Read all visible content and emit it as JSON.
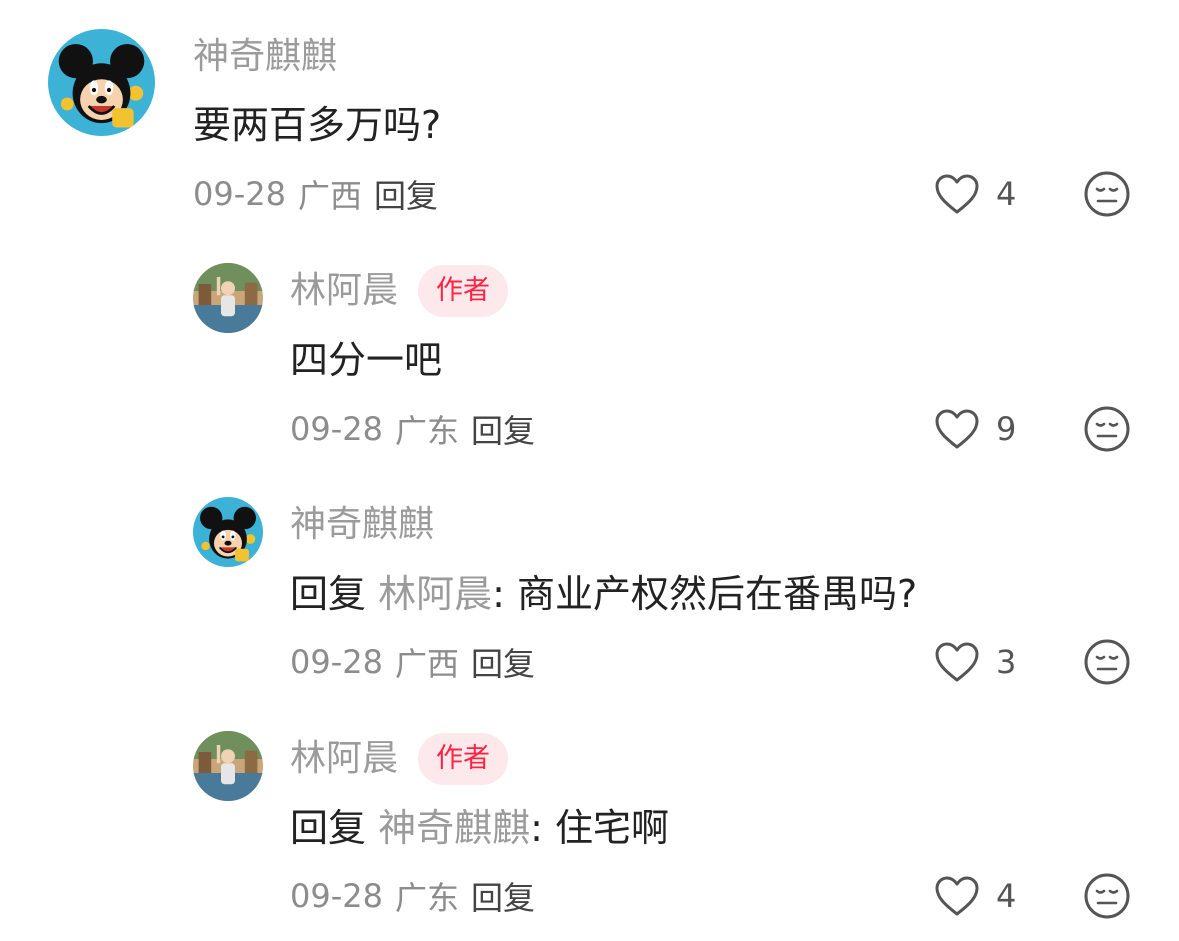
{
  "colors": {
    "username": "#9b9b9b",
    "text": "#222222",
    "author_badge_bg": "#fde8ec",
    "author_badge_text": "#ff2442",
    "meta": "#8c8c8c"
  },
  "comments": [
    {
      "username": "神奇麒麒",
      "avatar_icon": "mickey-mouse-avatar",
      "text": "要两百多万吗?",
      "date": "09-28",
      "location": "广西",
      "reply_label": "回复",
      "likes": "4",
      "like_icon": "heart-icon",
      "emoji_icon": "neutral-face-icon"
    },
    {
      "username": "林阿晨",
      "avatar_icon": "person-photo-avatar",
      "author_badge": "作者",
      "text": "四分一吧",
      "date": "09-28",
      "location": "广东",
      "reply_label": "回复",
      "likes": "9",
      "like_icon": "heart-icon",
      "emoji_icon": "neutral-face-icon"
    },
    {
      "username": "神奇麒麒",
      "avatar_icon": "mickey-mouse-avatar",
      "reply_prefix": "回复",
      "reply_to": "林阿晨",
      "text": ": 商业产权然后在番禺吗?",
      "date": "09-28",
      "location": "广西",
      "reply_label": "回复",
      "likes": "3",
      "like_icon": "heart-icon",
      "emoji_icon": "neutral-face-icon"
    },
    {
      "username": "林阿晨",
      "avatar_icon": "person-photo-avatar",
      "author_badge": "作者",
      "reply_prefix": "回复",
      "reply_to": "神奇麒麒",
      "text": ": 住宅啊",
      "date": "09-28",
      "location": "广东",
      "reply_label": "回复",
      "likes": "4",
      "like_icon": "heart-icon",
      "emoji_icon": "neutral-face-icon"
    }
  ]
}
